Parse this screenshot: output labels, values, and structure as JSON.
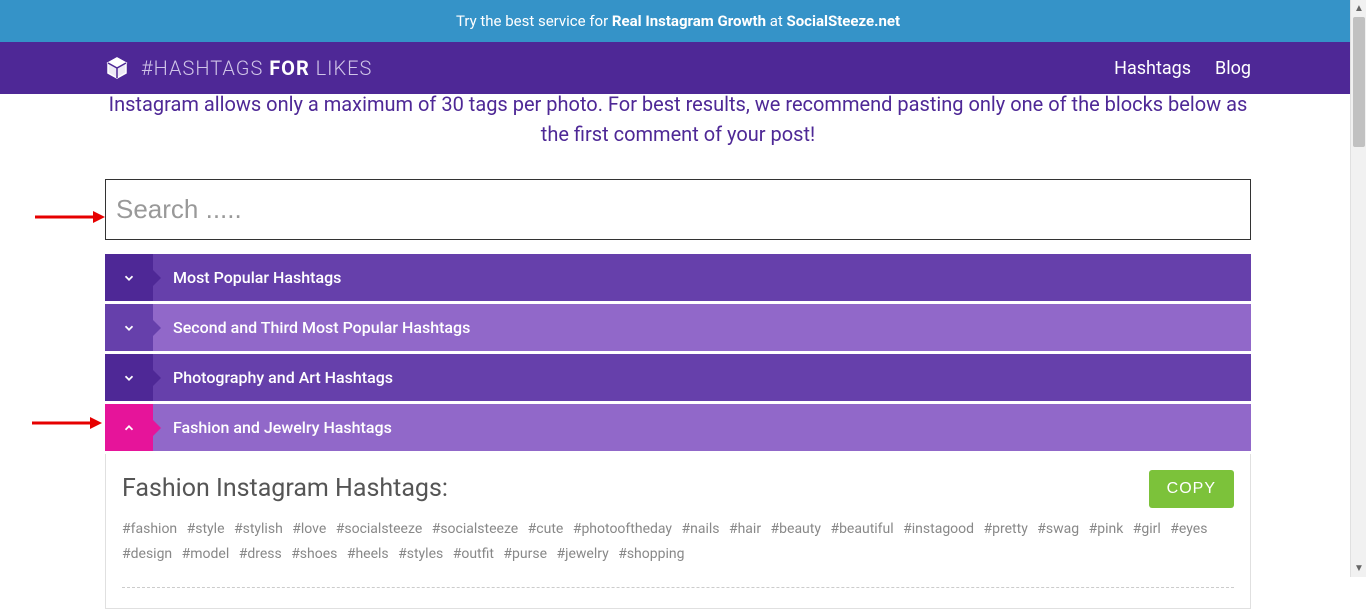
{
  "banner": {
    "prefix": "Try the best service for ",
    "bold": "Real Instagram Growth",
    "mid": " at ",
    "site": "SocialSteeze.net"
  },
  "logo": {
    "part1": "#HASHTAGS ",
    "part2": "FOR",
    "part3": " LIKES"
  },
  "nav": {
    "hashtags": "Hashtags",
    "blog": "Blog"
  },
  "intro": "Instagram allows only a maximum of 30 tags per photo. For best results, we recommend pasting only one of the blocks below as the first comment of your post!",
  "search": {
    "placeholder": "Search ....."
  },
  "accordion": [
    {
      "label": "Most Popular Hashtags",
      "expanded": false,
      "variant": "dark"
    },
    {
      "label": "Second and Third Most Popular Hashtags",
      "expanded": false,
      "variant": "light"
    },
    {
      "label": "Photography and Art Hashtags",
      "expanded": false,
      "variant": "dark"
    },
    {
      "label": "Fashion and Jewelry Hashtags",
      "expanded": true,
      "variant": "active"
    }
  ],
  "expanded_panel": {
    "title": "Fashion Instagram Hashtags:",
    "copy_label": "COPY",
    "hashtags": "#fashion   #style   #stylish   #love   #socialsteeze   #socialsteeze   #cute   #photooftheday   #nails   #hair   #beauty   #beautiful   #instagood   #pretty   #swag   #pink   #girl   #eyes   #design   #model   #dress   #shoes   #heels   #styles   #outfit   #purse   #jewelry   #shopping"
  }
}
